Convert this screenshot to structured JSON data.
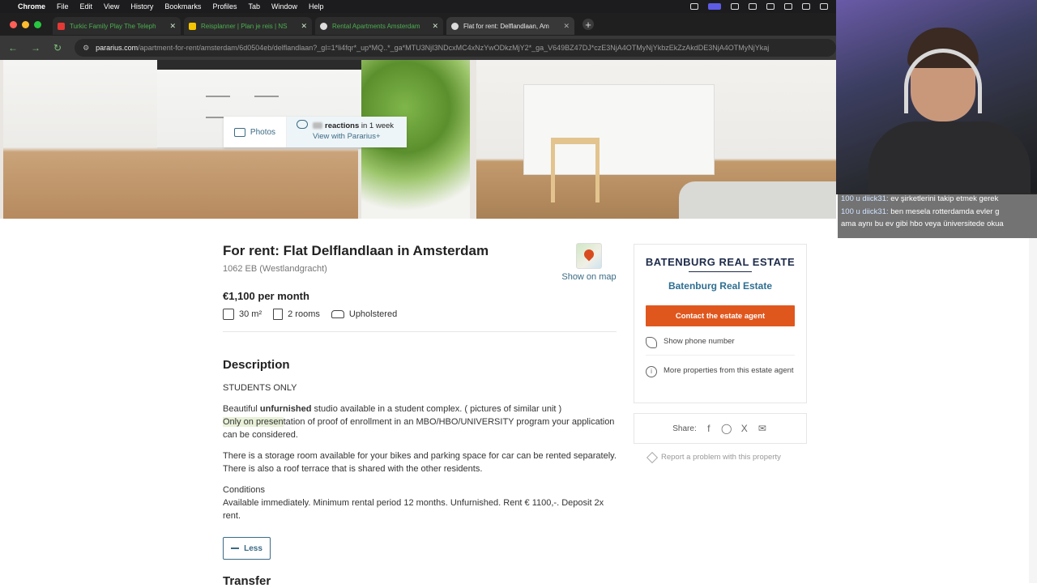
{
  "menubar": {
    "app": "Chrome",
    "items": [
      "File",
      "Edit",
      "View",
      "History",
      "Bookmarks",
      "Profiles",
      "Tab",
      "Window",
      "Help"
    ]
  },
  "tabs": [
    {
      "label": "Turkic Family Play The Teleph",
      "color": "#e53935",
      "active": false
    },
    {
      "label": "Reisplanner | Plan je reis | NS",
      "color": "#f5c400",
      "active": false
    },
    {
      "label": "Rental Apartments Amsterdam",
      "color": "#dcdcdc",
      "active": false
    },
    {
      "label": "Flat for rent: Delflandlaan, Am",
      "color": "#dcdcdc",
      "active": true
    }
  ],
  "address": {
    "host": "pararius.com",
    "path": "/apartment-for-rent/amsterdam/6d0504eb/delflandlaan?_gl=1*li4fqr*_up*MQ..*_ga*MTU3NjI3NDcxMC4xNzYwODkzMjY2*_ga_V649BZ47DJ*czE3NjA4OTMyNjYkbzEkZzAkdDE3NjA4OTMyNjYkaj"
  },
  "photo_tools": {
    "photos_label": "Photos",
    "reactions_label": "reactions",
    "reactions_period": "in 1 week",
    "view_with": "View with Pararius+"
  },
  "listing": {
    "title": "For rent: Flat Delflandlaan in Amsterdam",
    "address": "1062 EB (Westlandgracht)",
    "map_label": "Show on map",
    "price": "€1,100 per month",
    "features": {
      "area": "30 m²",
      "rooms": "2 rooms",
      "interior": "Upholstered"
    },
    "description_heading": "Description",
    "desc_line1": "STUDENTS ONLY",
    "desc_p2_a": "Beautiful ",
    "desc_p2_bold": "unfurnished",
    "desc_p2_b": " studio available in a student complex. ( pictures of similar unit )",
    "desc_p2_hl": "Only on presen",
    "desc_p2_c": "tation of proof of enrollment in an MBO/HBO/UNIVERSITY program your application can be considered.",
    "desc_p3": "There is a storage room available for your bikes and parking space for car can be rented separately. There is also a roof terrace that is shared with the other residents.",
    "conditions_label": "Conditions",
    "conditions_text": "Available immediately. Minimum rental period 12 months. Unfurnished. Rent € 1100,-. Deposit 2x rent.",
    "less_label": "Less",
    "transfer_heading": "Transfer"
  },
  "agent": {
    "logo_text": "BATENBURG REAL ESTATE",
    "name": "Batenburg Real Estate",
    "contact_label": "Contact the estate agent",
    "phone_label": "Show phone number",
    "more_label": "More properties from this estate agent"
  },
  "share": {
    "label": "Share:"
  },
  "report_label": "Report a problem with this property",
  "chat": [
    {
      "user": "100  u  diick31:",
      "text": " ev şirketlerini takip etmek gerek"
    },
    {
      "user": "100  u  diick31:",
      "text": " ben mesela rotterdamda evler g"
    },
    {
      "user": "",
      "text": "ama aynı bu ev gibi hbo veya üniversitede okua"
    }
  ],
  "colors": {
    "accent": "#3b6b84",
    "contact_button": "#e0571e",
    "agent_name": "#2f6f92"
  }
}
